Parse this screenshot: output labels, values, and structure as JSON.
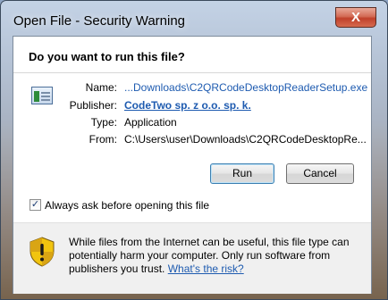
{
  "window": {
    "title": "Open File - Security Warning",
    "close_label": "X"
  },
  "dialog": {
    "heading": "Do you want to run this file?",
    "file_icon": "executable-file-icon",
    "fields": {
      "name_label": "Name:",
      "name_value": "...Downloads\\C2QRCodeDesktopReaderSetup.exe",
      "publisher_label": "Publisher:",
      "publisher_value": "CodeTwo sp. z o.o. sp. k.",
      "type_label": "Type:",
      "type_value": "Application",
      "from_label": "From:",
      "from_value": "C:\\Users\\user\\Downloads\\C2QRCodeDesktopRe..."
    },
    "buttons": {
      "run": "Run",
      "cancel": "Cancel"
    },
    "checkbox": {
      "label": "Always ask before opening this file",
      "checked": true,
      "mark": "✓"
    },
    "footer": {
      "shield_icon": "security-shield-icon",
      "warning_text": "While files from the Internet can be useful, this file type can potentially harm your computer. Only run software from publishers you trust.",
      "risk_link": "What's the risk?"
    }
  },
  "colors": {
    "link": "#1e5bb0",
    "shield_red": "#c0392b",
    "shield_yellow": "#f1c40f"
  }
}
